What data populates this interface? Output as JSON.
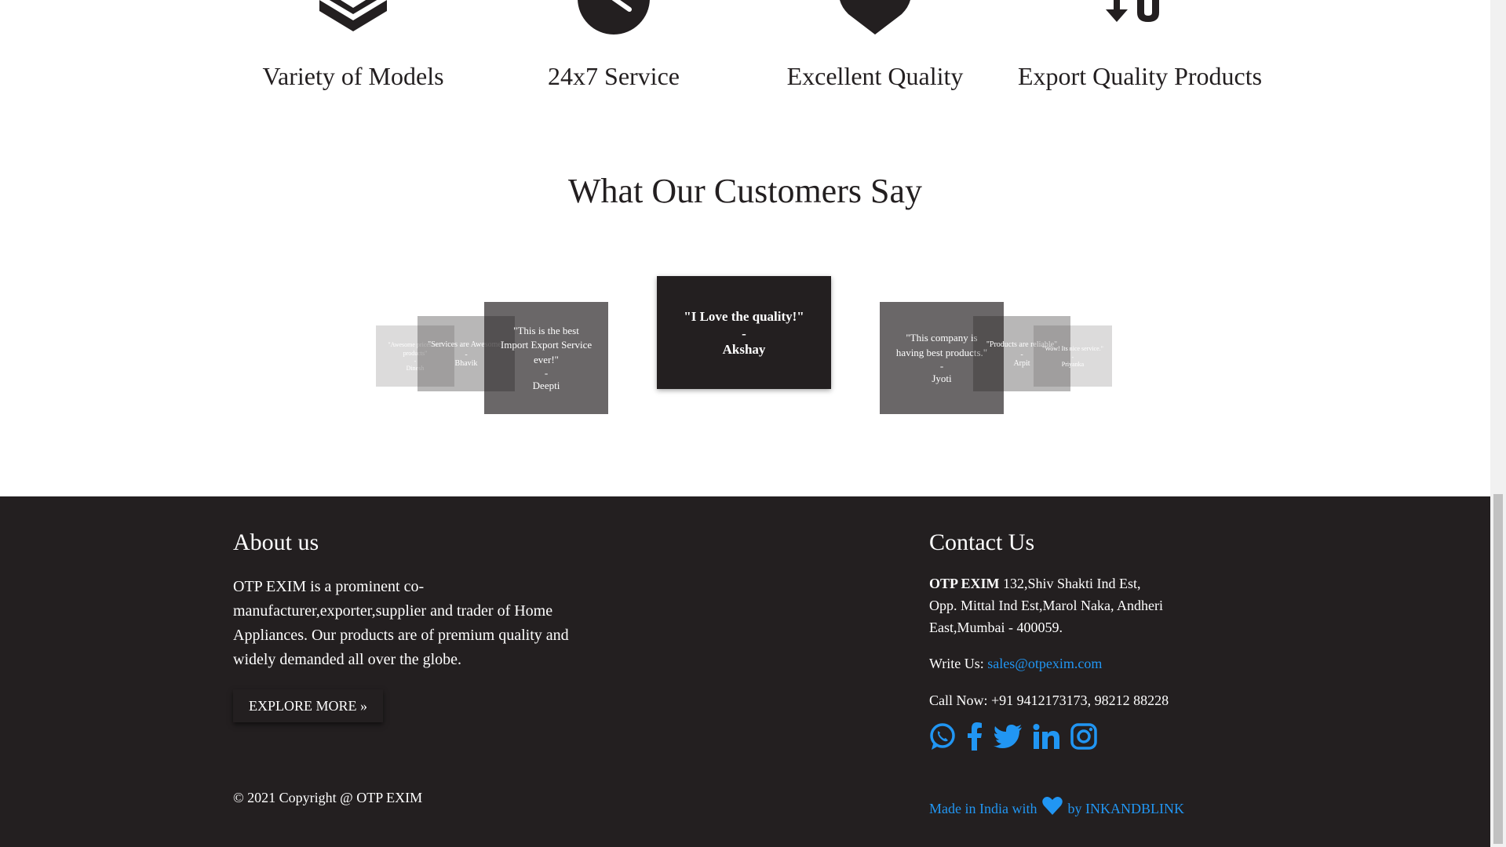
{
  "features": [
    {
      "icon": "layers-icon",
      "label": "Variety of Models"
    },
    {
      "icon": "clock-icon",
      "label": "24x7 Service"
    },
    {
      "icon": "heart-icon",
      "label": "Excellent Quality"
    },
    {
      "icon": "sort-icon",
      "label": "Export Quality Products"
    }
  ],
  "testimonials": {
    "title": "What Our Customers Say",
    "cards": [
      {
        "quote": "\"Awesome prices and products\"",
        "dash": "-",
        "name": "Dinesh"
      },
      {
        "quote": "\"Services are Awesome\"",
        "dash": "-",
        "name": "Bhavik"
      },
      {
        "quote": "\"This is the best Import Export Service ever!\"",
        "dash": "-",
        "name": "Deepti"
      },
      {
        "quote": "\"I Love the quality!\"",
        "dash": "-",
        "name": "Akshay"
      },
      {
        "quote": "\"This company is having best products.\"",
        "dash": "-",
        "name": "Jyoti"
      },
      {
        "quote": "\"Products are reliable\"",
        "dash": "-",
        "name": "Arpit"
      },
      {
        "quote": "\"Wow! Its nice service.\"",
        "dash": "-",
        "name": "Priyanka"
      }
    ]
  },
  "footer": {
    "about": {
      "heading": "About us",
      "text": "OTP EXIM is a prominent co-manufacturer,exporter,supplier and trader of Home Appliances. Our products are of premium quality and widely demanded all over the globe.",
      "button": "EXPLORE MORE »"
    },
    "copyright": "© 2021 Copyright @ OTP EXIM",
    "contact": {
      "heading": "Contact Us",
      "company": "OTP EXIM",
      "address": "132,Shiv Shakti Ind Est, Opp. Mittal Ind Est,Marol Naka, Andheri East,Mumbai - 400059.",
      "write_label": "Write Us:",
      "email": "sales@otpexim.com",
      "call_label": "Call Now:",
      "phone": "+91 9412173173, 98212 88228"
    },
    "socials": [
      "whatsapp-icon",
      "facebook-icon",
      "twitter-icon",
      "linkedin-icon",
      "instagram-icon"
    ],
    "made_prefix": "Made in India with",
    "made_suffix": "by INKANDBLINK"
  },
  "colors": {
    "dark": "#231f20",
    "accent": "#2196f3",
    "white": "#ffffff"
  }
}
